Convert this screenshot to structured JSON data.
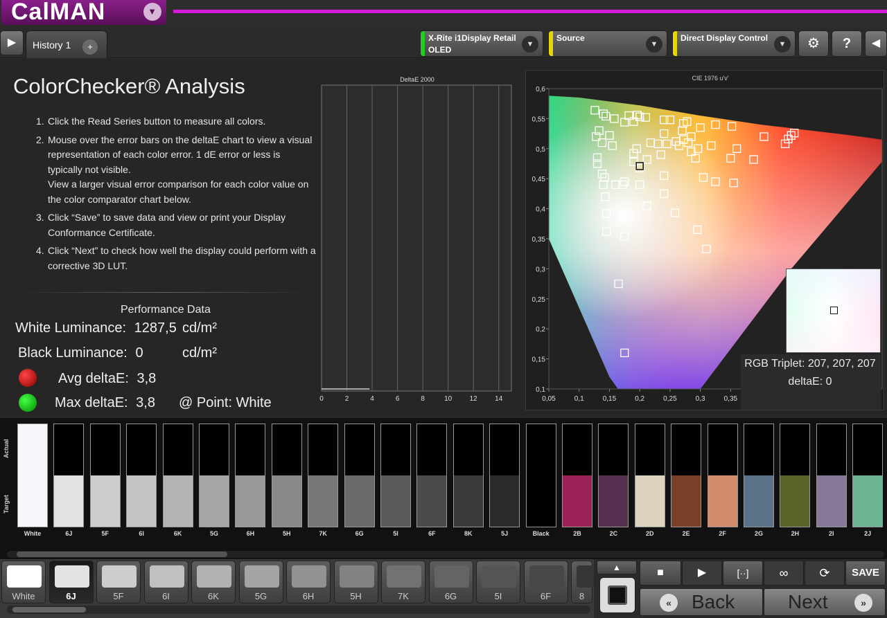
{
  "app": {
    "logo": "CalMAN"
  },
  "tabs": {
    "history": "History 1",
    "add": "+"
  },
  "devices": [
    {
      "line1": "X-Rite i1Display Retail",
      "line2": "OLED",
      "color": "#22cc22"
    },
    {
      "line1": "Source",
      "line2": "",
      "color": "#e5d800"
    },
    {
      "line1": "Direct Display Control",
      "line2": "",
      "color": "#e5d800"
    }
  ],
  "page": {
    "title": "ColorChecker® Analysis",
    "steps": [
      {
        "num": "1.",
        "text": "Click the Read Series button to measure all colors."
      },
      {
        "num": "2.",
        "text": "Mouse over the error bars on the deltaE chart to view a visual representation of each color error. 1 dE error or less is typically not visible."
      },
      {
        "num": "",
        "text": "View a larger visual error comparison for each color value on the color comparator chart below."
      },
      {
        "num": "3.",
        "text": "Click “Save” to save data and view or print your Display Conformance Certificate."
      },
      {
        "num": "4.",
        "text": "Click “Next” to check how well the display could perform with a corrective 3D LUT."
      }
    ]
  },
  "performance": {
    "title": "Performance Data",
    "white_label": "White Luminance:",
    "white_value": "1287,5",
    "white_unit": "cd/m²",
    "black_label": "Black Luminance:",
    "black_value": "0",
    "black_unit": "cd/m²",
    "avg_label": "Avg deltaE:",
    "avg_value": "3,8",
    "max_label": "Max deltaE:",
    "max_value": "3,8",
    "point_label": "@ Point: White"
  },
  "chart_data": [
    {
      "type": "bar",
      "title": "DeltaE 2000",
      "orientation": "horizontal",
      "xlim": [
        0,
        15
      ],
      "xticks": [
        0,
        2,
        4,
        6,
        8,
        10,
        12,
        14
      ],
      "values": [
        3.8
      ]
    },
    {
      "type": "scatter",
      "title": "CIE 1976 u'v'",
      "xlim": [
        0.05,
        0.6
      ],
      "ylim": [
        0.1,
        0.6
      ],
      "xticks": [
        "0,05",
        "0,1",
        "0,15",
        "0,2",
        "0,25",
        "0,3",
        "0,35",
        "0,4",
        "0,45",
        "0,5",
        "0,55"
      ],
      "yticks": [
        "0,6",
        "0,55",
        "0,5",
        "0,45",
        "0,4",
        "0,35",
        "0,3",
        "0,25",
        "0,2",
        "0,15",
        "0,1"
      ],
      "points": [
        [
          0.126,
          0.564
        ],
        [
          0.14,
          0.558
        ],
        [
          0.144,
          0.554
        ],
        [
          0.133,
          0.53
        ],
        [
          0.128,
          0.52
        ],
        [
          0.15,
          0.522
        ],
        [
          0.155,
          0.505
        ],
        [
          0.138,
          0.51
        ],
        [
          0.13,
          0.485
        ],
        [
          0.13,
          0.475
        ],
        [
          0.142,
          0.452
        ],
        [
          0.138,
          0.458
        ],
        [
          0.14,
          0.44
        ],
        [
          0.16,
          0.44
        ],
        [
          0.172,
          0.44
        ],
        [
          0.175,
          0.445
        ],
        [
          0.143,
          0.42
        ],
        [
          0.158,
          0.55
        ],
        [
          0.175,
          0.544
        ],
        [
          0.19,
          0.545
        ],
        [
          0.182,
          0.555
        ],
        [
          0.196,
          0.556
        ],
        [
          0.2,
          0.553
        ],
        [
          0.21,
          0.552
        ],
        [
          0.24,
          0.548
        ],
        [
          0.25,
          0.548
        ],
        [
          0.272,
          0.542
        ],
        [
          0.278,
          0.545
        ],
        [
          0.3,
          0.535
        ],
        [
          0.325,
          0.54
        ],
        [
          0.352,
          0.537
        ],
        [
          0.27,
          0.53
        ],
        [
          0.24,
          0.525
        ],
        [
          0.218,
          0.51
        ],
        [
          0.23,
          0.508
        ],
        [
          0.245,
          0.508
        ],
        [
          0.26,
          0.512
        ],
        [
          0.272,
          0.515
        ],
        [
          0.285,
          0.52
        ],
        [
          0.28,
          0.51
        ],
        [
          0.265,
          0.505
        ],
        [
          0.195,
          0.5
        ],
        [
          0.19,
          0.492
        ],
        [
          0.19,
          0.478
        ],
        [
          0.2,
          0.468
        ],
        [
          0.212,
          0.482
        ],
        [
          0.235,
          0.49
        ],
        [
          0.285,
          0.495
        ],
        [
          0.292,
          0.484
        ],
        [
          0.296,
          0.5
        ],
        [
          0.318,
          0.505
        ],
        [
          0.35,
          0.484
        ],
        [
          0.36,
          0.5
        ],
        [
          0.388,
          0.482
        ],
        [
          0.405,
          0.52
        ],
        [
          0.44,
          0.508
        ],
        [
          0.445,
          0.516
        ],
        [
          0.45,
          0.522
        ],
        [
          0.455,
          0.526
        ],
        [
          0.2,
          0.44
        ],
        [
          0.24,
          0.455
        ],
        [
          0.24,
          0.425
        ],
        [
          0.212,
          0.405
        ],
        [
          0.258,
          0.393
        ],
        [
          0.305,
          0.452
        ],
        [
          0.325,
          0.445
        ],
        [
          0.355,
          0.443
        ],
        [
          0.295,
          0.365
        ],
        [
          0.31,
          0.333
        ],
        [
          0.175,
          0.354
        ],
        [
          0.145,
          0.362
        ],
        [
          0.145,
          0.392
        ],
        [
          0.165,
          0.275
        ],
        [
          0.175,
          0.16
        ]
      ],
      "highlight_point": [
        0.2,
        0.471
      ]
    }
  ],
  "zoom": {
    "rgb_triplet": "RGB Triplet: 207, 207, 207",
    "delta": "deltaE: 0"
  },
  "comparator": {
    "actual_label": "Actual",
    "target_label": "Target",
    "swatches": [
      {
        "label": "White",
        "actual": "#f7f7fb",
        "target": "#f7f7fb"
      },
      {
        "label": "6J",
        "actual": "#000000",
        "target": "#e2e2e2"
      },
      {
        "label": "5F",
        "actual": "#000000",
        "target": "#cdcdcd"
      },
      {
        "label": "6I",
        "actual": "#000000",
        "target": "#c4c4c4"
      },
      {
        "label": "6K",
        "actual": "#000000",
        "target": "#b4b4b4"
      },
      {
        "label": "5G",
        "actual": "#000000",
        "target": "#a6a6a6"
      },
      {
        "label": "6H",
        "actual": "#000000",
        "target": "#999999"
      },
      {
        "label": "5H",
        "actual": "#000000",
        "target": "#8a8a8a"
      },
      {
        "label": "7K",
        "actual": "#000000",
        "target": "#777777"
      },
      {
        "label": "6G",
        "actual": "#000000",
        "target": "#6a6a6a"
      },
      {
        "label": "5I",
        "actual": "#000000",
        "target": "#5a5a5a"
      },
      {
        "label": "6F",
        "actual": "#000000",
        "target": "#4b4b4b"
      },
      {
        "label": "8K",
        "actual": "#000000",
        "target": "#3a3a3a"
      },
      {
        "label": "5J",
        "actual": "#000000",
        "target": "#2b2b2b"
      },
      {
        "label": "Black",
        "actual": "#000000",
        "target": "#000000"
      },
      {
        "label": "2B",
        "actual": "#000000",
        "target": "#9c2358"
      },
      {
        "label": "2C",
        "actual": "#000000",
        "target": "#54304e"
      },
      {
        "label": "2D",
        "actual": "#000000",
        "target": "#dcd4c0"
      },
      {
        "label": "2E",
        "actual": "#000000",
        "target": "#7a4028"
      },
      {
        "label": "2F",
        "actual": "#000000",
        "target": "#d28c6c"
      },
      {
        "label": "2G",
        "actual": "#000000",
        "target": "#5a7288"
      },
      {
        "label": "2H",
        "actual": "#000000",
        "target": "#5a6228"
      },
      {
        "label": "2I",
        "actual": "#000000",
        "target": "#88789a"
      },
      {
        "label": "2J",
        "actual": "#000000",
        "target": "#6ab494"
      }
    ]
  },
  "bottom": {
    "tiles": [
      {
        "label": "White",
        "color": "#ffffff"
      },
      {
        "label": "6J",
        "color": "#e2e2e2"
      },
      {
        "label": "5F",
        "color": "#cdcdcd"
      },
      {
        "label": "6I",
        "color": "#c0c0c0"
      },
      {
        "label": "6K",
        "color": "#b2b2b2"
      },
      {
        "label": "5G",
        "color": "#a4a4a4"
      },
      {
        "label": "6H",
        "color": "#929292"
      },
      {
        "label": "5H",
        "color": "#828282"
      },
      {
        "label": "7K",
        "color": "#727272"
      },
      {
        "label": "6G",
        "color": "#646464"
      },
      {
        "label": "5I",
        "color": "#555555"
      },
      {
        "label": "6F",
        "color": "#474747"
      },
      {
        "label": "8",
        "color": "#363636"
      }
    ],
    "save_label": "SAVE",
    "back_label": "Back",
    "next_label": "Next"
  }
}
